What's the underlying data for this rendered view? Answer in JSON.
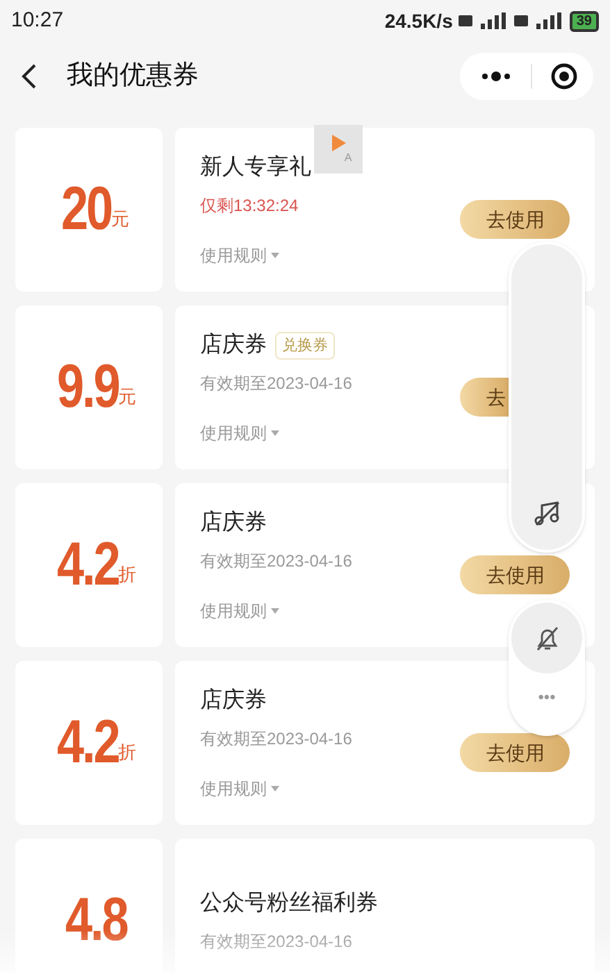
{
  "status_bar": {
    "time": "10:27",
    "speed": "24.5K/s",
    "battery": "39"
  },
  "header": {
    "title": "我的优惠券"
  },
  "floating_badge": {
    "label": "A"
  },
  "coupons": [
    {
      "value": "20",
      "unit": "元",
      "title": "新人专享礼",
      "info": "仅剩13:32:24",
      "urgent": true,
      "rules": "使用规则",
      "button": "去使用",
      "button_covered": false
    },
    {
      "value": "9.9",
      "unit": "元",
      "title": "店庆券",
      "tag": "兑换券",
      "info": "有效期至2023-04-16",
      "urgent": false,
      "rules": "使用规则",
      "button": "去",
      "button_covered": true
    },
    {
      "value": "4.2",
      "unit": "折",
      "title": "店庆券",
      "info": "有效期至2023-04-16",
      "urgent": false,
      "rules": "使用规则",
      "button": "去使用",
      "button_covered": false
    },
    {
      "value": "4.2",
      "unit": "折",
      "title": "店庆券",
      "info": "有效期至2023-04-16",
      "urgent": false,
      "rules": "使用规则",
      "button": "去使用",
      "button_covered": false
    },
    {
      "value": "4.8",
      "title": "公众号粉丝福利券",
      "info": "有效期至2023-04-16",
      "urgent": false
    }
  ],
  "more_label": "•••"
}
